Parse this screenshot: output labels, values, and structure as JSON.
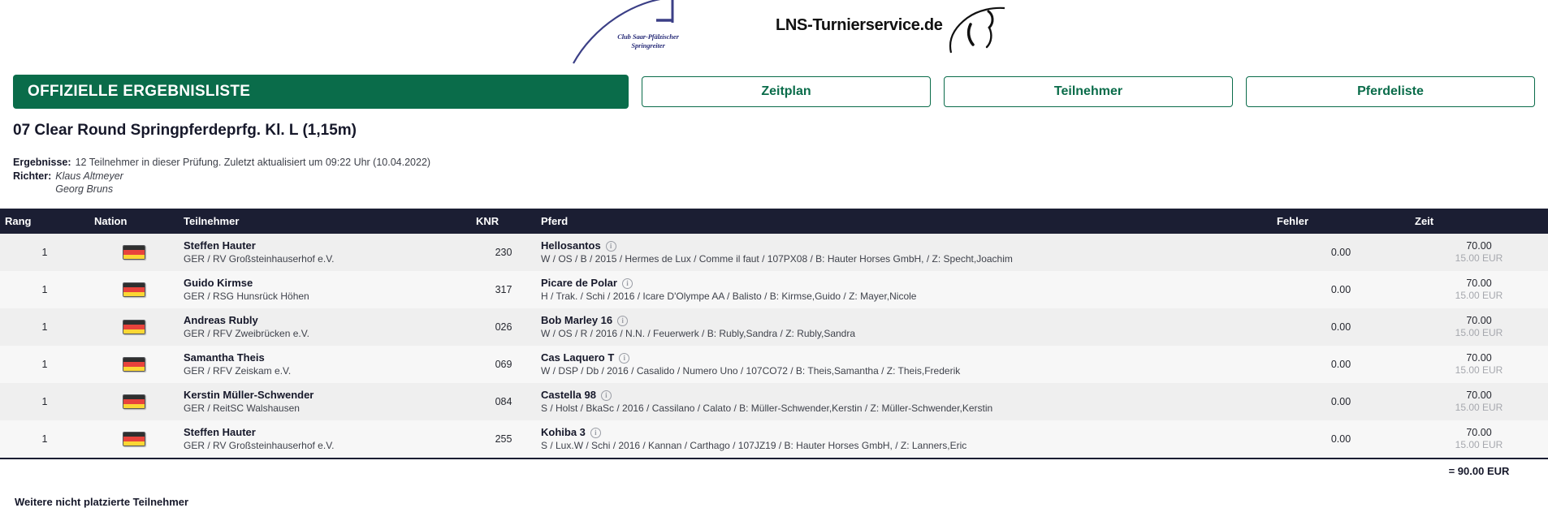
{
  "logos": {
    "club": {
      "line1": "Club Saar-Pfälzischer",
      "line2": "Springreiter"
    },
    "service": {
      "text": "LNS-Turnierservice.de"
    }
  },
  "header": {
    "banner": "OFFIZIELLE ERGEBNISLISTE",
    "buttons": [
      {
        "label": "Zeitplan"
      },
      {
        "label": "Teilnehmer"
      },
      {
        "label": "Pferdeliste"
      }
    ],
    "accent_green": "#0a6c4a",
    "table_header_bg": "#1b1e33"
  },
  "competition": {
    "title": "07 Clear Round Springpferdeprfg. Kl. L (1,15m)"
  },
  "meta": {
    "results_label": "Ergebnisse:",
    "results_value": "12 Teilnehmer in dieser Prüfung. Zuletzt aktualisiert um 09:22 Uhr (10.04.2022)",
    "judges_label": "Richter:",
    "judges": [
      "Klaus Altmeyer",
      "Georg Bruns"
    ]
  },
  "table": {
    "columns": {
      "rang": "Rang",
      "nation": "Nation",
      "teilnehmer": "Teilnehmer",
      "knr": "KNR",
      "pferd": "Pferd",
      "fehler": "Fehler",
      "zeit": "Zeit"
    },
    "rows": [
      {
        "rang": "1",
        "nation": "GER",
        "rider": "Steffen Hauter",
        "club": "GER / RV Großsteinhauserhof e.V.",
        "knr": "230",
        "horse": "Hellosantos",
        "pedigree": "W / OS / B / 2015 / Hermes de Lux / Comme il faut / 107PX08 / B: Hauter Horses GmbH, / Z: Specht,Joachim",
        "fehler": "0.00",
        "zeit": "70.00",
        "prize": "15.00 EUR"
      },
      {
        "rang": "1",
        "nation": "GER",
        "rider": "Guido Kirmse",
        "club": "GER / RSG Hunsrück Höhen",
        "knr": "317",
        "horse": "Picare de Polar",
        "pedigree": "H / Trak. / Schi / 2016 / Icare D'Olympe AA / Balisto / B: Kirmse,Guido / Z: Mayer,Nicole",
        "fehler": "0.00",
        "zeit": "70.00",
        "prize": "15.00 EUR"
      },
      {
        "rang": "1",
        "nation": "GER",
        "rider": "Andreas Rubly",
        "club": "GER / RFV Zweibrücken e.V.",
        "knr": "026",
        "horse": "Bob Marley 16",
        "pedigree": "W / OS / R / 2016 / N.N. / Feuerwerk / B: Rubly,Sandra / Z: Rubly,Sandra",
        "fehler": "0.00",
        "zeit": "70.00",
        "prize": "15.00 EUR"
      },
      {
        "rang": "1",
        "nation": "GER",
        "rider": "Samantha Theis",
        "club": "GER / RFV Zeiskam e.V.",
        "knr": "069",
        "horse": "Cas Laquero T",
        "pedigree": "W / DSP / Db / 2016 / Casalido / Numero Uno / 107CO72 / B: Theis,Samantha / Z: Theis,Frederik",
        "fehler": "0.00",
        "zeit": "70.00",
        "prize": "15.00 EUR"
      },
      {
        "rang": "1",
        "nation": "GER",
        "rider": "Kerstin Müller-Schwender",
        "club": "GER / ReitSC Walshausen",
        "knr": "084",
        "horse": "Castella 98",
        "pedigree": "S / Holst / BkaSc / 2016 / Cassilano / Calato / B: Müller-Schwender,Kerstin / Z: Müller-Schwender,Kerstin",
        "fehler": "0.00",
        "zeit": "70.00",
        "prize": "15.00 EUR"
      },
      {
        "rang": "1",
        "nation": "GER",
        "rider": "Steffen Hauter",
        "club": "GER / RV Großsteinhauserhof e.V.",
        "knr": "255",
        "horse": "Kohiba 3",
        "pedigree": "S / Lux.W / Schi / 2016 / Kannan / Carthago / 107JZ19 / B: Hauter Horses GmbH, / Z: Lanners,Eric",
        "fehler": "0.00",
        "zeit": "70.00",
        "prize": "15.00 EUR"
      }
    ],
    "total": "= 90.00 EUR"
  },
  "footer": {
    "note": "Weitere nicht platzierte Teilnehmer"
  },
  "icons": {
    "info": "i"
  }
}
